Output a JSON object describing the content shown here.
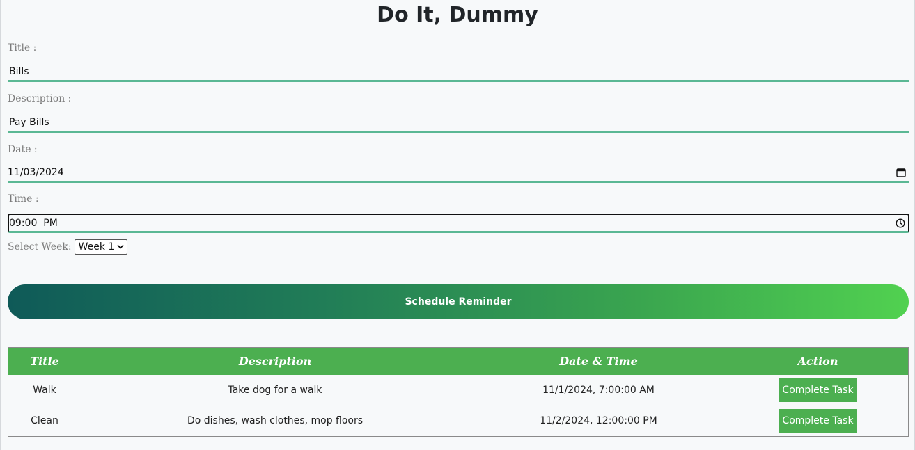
{
  "app": {
    "title": "Do It, Dummy"
  },
  "form": {
    "title_label": "Title :",
    "title_value": "Bills",
    "description_label": "Description :",
    "description_value": "Pay Bills",
    "date_label": "Date :",
    "date_value": "11/03/2024",
    "time_label": "Time :",
    "time_value": "09:00  PM",
    "week_label": "Select Week:",
    "week_selected": "Week 1",
    "submit_label": "Schedule Reminder"
  },
  "table": {
    "headers": [
      "Title",
      "Description",
      "Date & Time",
      "Action"
    ],
    "rows": [
      {
        "title": "Walk",
        "description": "Take dog for a walk",
        "datetime": "11/1/2024, 7:00:00 AM",
        "action": "Complete Task"
      },
      {
        "title": "Clean",
        "description": "Do dishes, wash clothes, mop floors",
        "datetime": "11/2/2024, 12:00:00 PM",
        "action": "Complete Task"
      }
    ]
  },
  "colors": {
    "accent_green": "#4caf50",
    "input_underline": "#5bb894",
    "gradient_start": "#0f5a58",
    "gradient_end": "#51d150"
  }
}
